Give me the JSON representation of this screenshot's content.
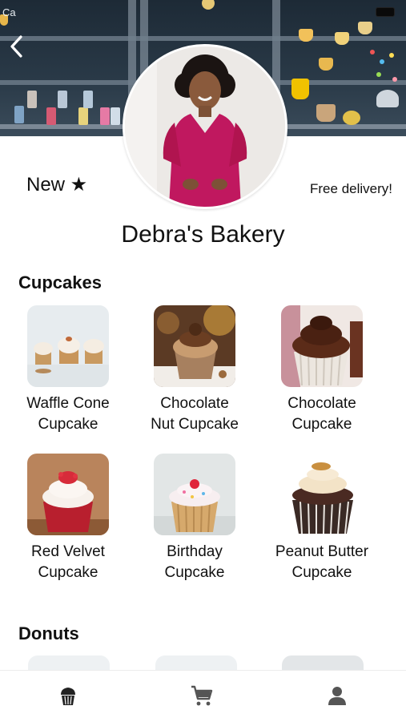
{
  "status_bar": {
    "left_text": "Ca"
  },
  "store": {
    "badge_new": "New ★",
    "delivery_note": "Free delivery!",
    "name": "Debra's Bakery"
  },
  "sections": [
    {
      "title": "Cupcakes",
      "items": [
        {
          "name": "Waffle Cone\nCupcake",
          "image": "waffle-cone-cupcake-photo"
        },
        {
          "name": "Chocolate\nNut Cupcake",
          "image": "chocolate-nut-cupcake-photo"
        },
        {
          "name": "Chocolate\nCupcake",
          "image": "chocolate-cupcake-photo"
        },
        {
          "name": "Red Velvet\nCupcake",
          "image": "red-velvet-cupcake-photo"
        },
        {
          "name": "Birthday\nCupcake",
          "image": "birthday-cupcake-photo"
        },
        {
          "name": "Peanut Butter\nCupcake",
          "image": "peanut-butter-cupcake-photo"
        }
      ]
    },
    {
      "title": "Donuts",
      "items": []
    }
  ],
  "nav": [
    {
      "icon": "cupcake-icon",
      "active": true
    },
    {
      "icon": "cart-icon",
      "active": false
    },
    {
      "icon": "profile-icon",
      "active": false
    }
  ],
  "colors": {
    "accent": "#c2185b",
    "icon": "#555555",
    "text": "#111111"
  }
}
